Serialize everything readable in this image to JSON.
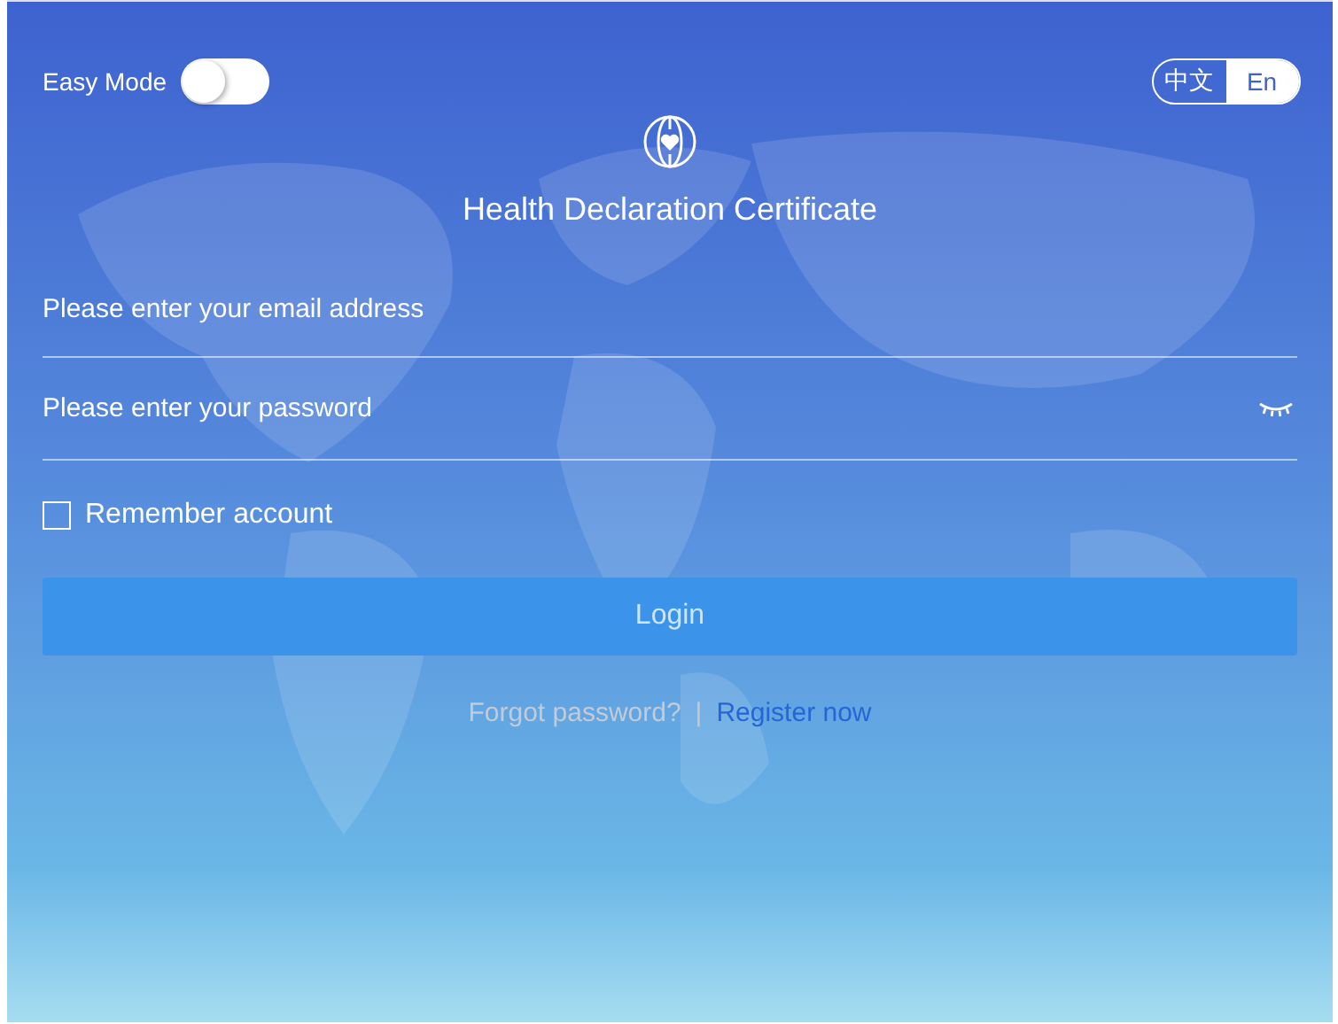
{
  "easy_mode": {
    "label": "Easy Mode",
    "on": false
  },
  "languages": [
    {
      "label": "中文",
      "selected": false
    },
    {
      "label": "En",
      "selected": true
    }
  ],
  "title": "Health Declaration Certificate",
  "email": {
    "placeholder": "Please enter your email address"
  },
  "password": {
    "placeholder": "Please enter your password"
  },
  "remember": {
    "label": "Remember account",
    "checked": false
  },
  "login_button": "Login",
  "links": {
    "forgot": "Forgot password?",
    "separator": "|",
    "register": "Register now"
  }
}
